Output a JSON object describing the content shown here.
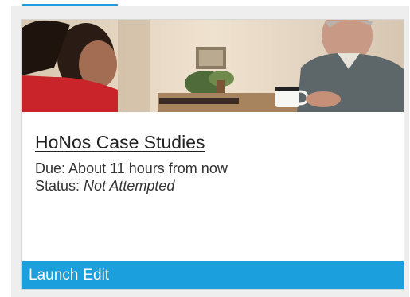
{
  "card": {
    "image_alt": "Case study photo",
    "title": "HoNos Case Studies",
    "due_label": "Due:",
    "due_value": "About 11 hours from now",
    "status_label": "Status:",
    "status_value": "Not Attempted"
  },
  "actions": {
    "launch_label": "Launch",
    "edit_label": "Edit"
  },
  "colors": {
    "accent": "#1ba0dd"
  }
}
